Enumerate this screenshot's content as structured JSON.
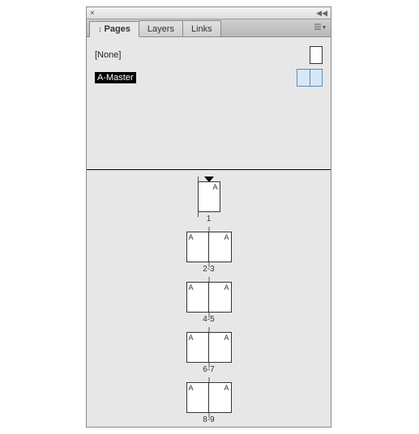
{
  "tabs": {
    "pages": "Pages",
    "layers": "Layers",
    "links": "Links"
  },
  "masters": {
    "none": "[None]",
    "amaster": "A-Master"
  },
  "spreads": [
    {
      "label": "1",
      "pages": [
        {
          "m": "A",
          "side": "right"
        }
      ],
      "start": true
    },
    {
      "label": "2-3",
      "pages": [
        {
          "m": "A",
          "side": "left"
        },
        {
          "m": "A",
          "side": "right"
        }
      ]
    },
    {
      "label": "4-5",
      "pages": [
        {
          "m": "A",
          "side": "left"
        },
        {
          "m": "A",
          "side": "right"
        }
      ]
    },
    {
      "label": "6-7",
      "pages": [
        {
          "m": "A",
          "side": "left"
        },
        {
          "m": "A",
          "side": "right"
        }
      ]
    },
    {
      "label": "8-9",
      "pages": [
        {
          "m": "A",
          "side": "left"
        },
        {
          "m": "A",
          "side": "right"
        }
      ]
    }
  ],
  "titlebar": {
    "close": "×",
    "expand": "◀◀"
  }
}
